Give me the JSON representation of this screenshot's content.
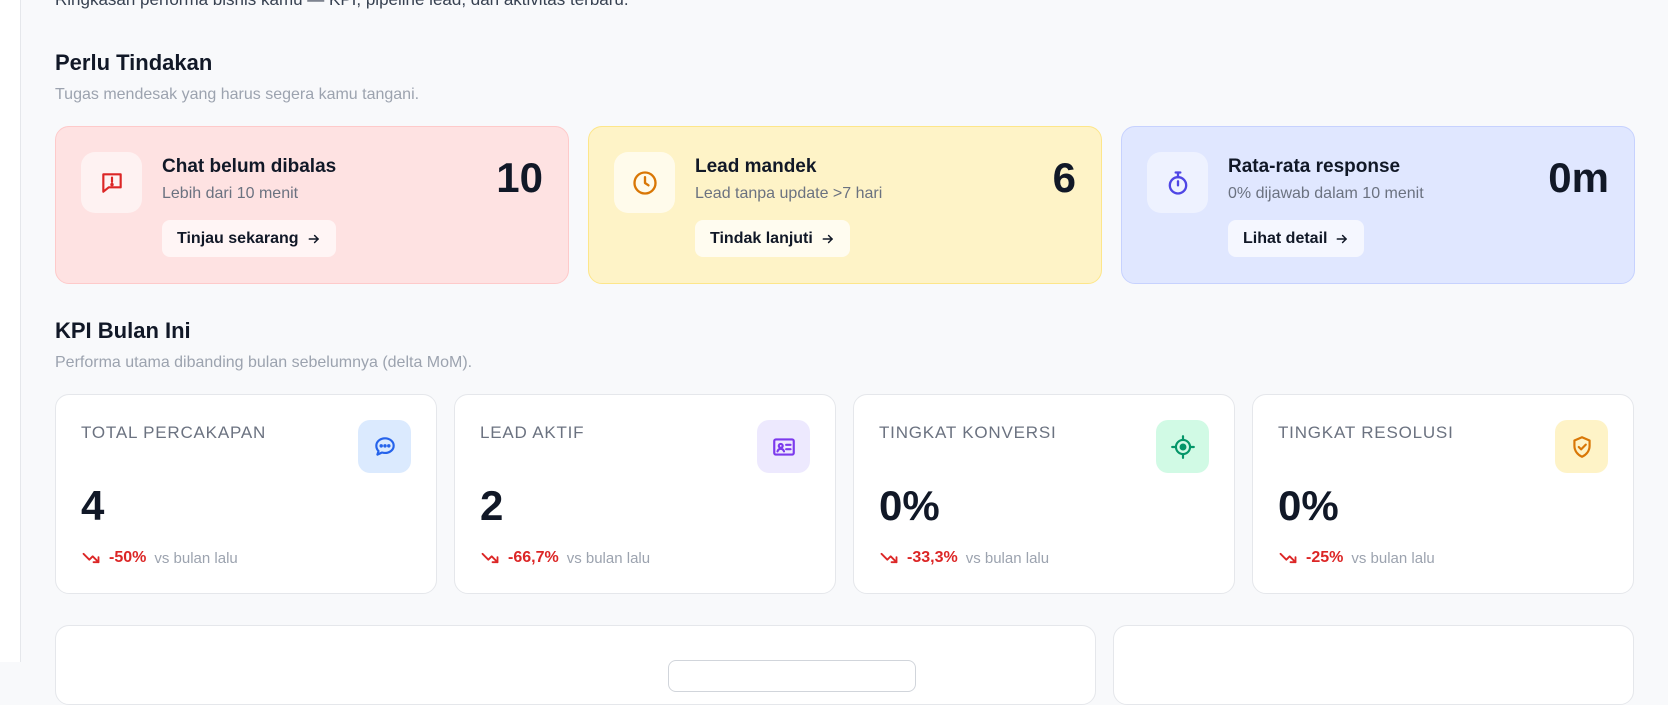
{
  "intro": "Ringkasan performa bisnis kamu — KPI, pipeline lead, dan aktivitas terbaru.",
  "action_section": {
    "title": "Perlu Tindakan",
    "subtitle": "Tugas mendesak yang harus segera kamu tangani.",
    "cards": [
      {
        "title": "Chat belum dibalas",
        "desc": "Lebih dari 10 menit",
        "button": "Tinjau sekarang",
        "value": "10",
        "icon": "alert-chat-icon",
        "color": "#dc2626"
      },
      {
        "title": "Lead mandek",
        "desc": "Lead tanpa update >7 hari",
        "button": "Tindak lanjuti",
        "value": "6",
        "icon": "clock-icon",
        "color": "#d97706"
      },
      {
        "title": "Rata-rata response",
        "desc": "0% dijawab dalam 10 menit",
        "button": "Lihat detail",
        "value": "0m",
        "icon": "stopwatch-icon",
        "color": "#4f46e5"
      }
    ]
  },
  "kpi_section": {
    "title": "KPI Bulan Ini",
    "subtitle": "Performa utama dibanding bulan sebelumnya (delta MoM).",
    "cards": [
      {
        "label": "TOTAL PERCAKAPAN",
        "value": "4",
        "delta": "-50%",
        "ref": "vs bulan lalu",
        "icon": "chat-bubble-icon",
        "icon_color": "#2563eb",
        "icon_bg": "#dbeafe"
      },
      {
        "label": "LEAD AKTIF",
        "value": "2",
        "delta": "-66,7%",
        "ref": "vs bulan lalu",
        "icon": "contact-card-icon",
        "icon_color": "#7c3aed",
        "icon_bg": "#ede9fe"
      },
      {
        "label": "TINGKAT KONVERSI",
        "value": "0%",
        "delta": "-33,3%",
        "ref": "vs bulan lalu",
        "icon": "target-icon",
        "icon_color": "#059669",
        "icon_bg": "#d1fae5"
      },
      {
        "label": "TINGKAT RESOLUSI",
        "value": "0%",
        "delta": "-25%",
        "ref": "vs bulan lalu",
        "icon": "shield-check-icon",
        "icon_color": "#d97706",
        "icon_bg": "#fef3c7"
      }
    ]
  },
  "colors": {
    "negative": "#dc2626",
    "background": "#f8f9fb"
  }
}
